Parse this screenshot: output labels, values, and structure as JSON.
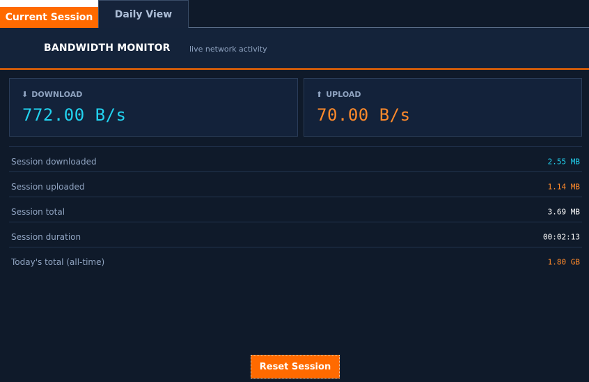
{
  "tabs": [
    {
      "label": "Current Session",
      "active": true
    },
    {
      "label": "Daily View",
      "active": false
    }
  ],
  "header": {
    "title": "BANDWIDTH MONITOR",
    "subtitle": "live network activity"
  },
  "download": {
    "icon": "download-arrow-icon",
    "glyph": "⬇",
    "label": "DOWNLOAD",
    "rate": "772.00 B/s",
    "color": "#22d3f0"
  },
  "upload": {
    "icon": "upload-arrow-icon",
    "glyph": "⬆",
    "label": "UPLOAD",
    "rate": "70.00 B/s",
    "color": "#ff8a2b"
  },
  "stats": [
    {
      "label": "Session downloaded",
      "value": "2.55 MB",
      "color": "#22d3f0"
    },
    {
      "label": "Session uploaded",
      "value": "1.14 MB",
      "color": "#ff8a2b"
    },
    {
      "label": "Session total",
      "value": "3.69 MB",
      "color": "#ffffff"
    },
    {
      "label": "Session duration",
      "value": "00:02:13",
      "color": "#ffffff"
    },
    {
      "label": "Today's total (all-time)",
      "value": "1.80 GB",
      "color": "#ff8a2b"
    }
  ],
  "actions": {
    "reset_label": "Reset Session"
  },
  "colors": {
    "accent": "#ff6a00",
    "background": "#0f1a2a",
    "panel": "#13223a"
  }
}
